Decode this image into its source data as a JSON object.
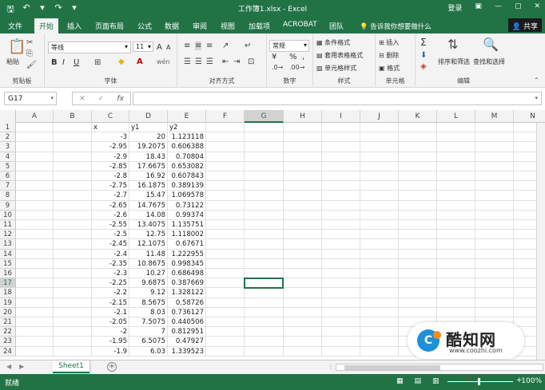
{
  "titlebar": {
    "save_icon": "save-icon",
    "undo": "↶",
    "undo_dd": "▾",
    "redo": "↷",
    "customize": "▾",
    "title": "工作簿1.xlsx  -  Excel",
    "signin": "登录",
    "ribbon_opts": "▣",
    "minimize": "—",
    "restore": "▢",
    "close": "✕"
  },
  "tabs": [
    "文件",
    "开始",
    "插入",
    "页面布局",
    "公式",
    "数据",
    "审阅",
    "视图",
    "加载项",
    "ACROBAT",
    "团队"
  ],
  "active_tab": "开始",
  "tellme": "告诉我你想要做什么",
  "share": "共享",
  "ribbon": {
    "clipboard": {
      "label": "剪贴板",
      "paste": "粘贴",
      "cut": "✂",
      "copy": "⎘",
      "painter": "🖌"
    },
    "font": {
      "label": "字体",
      "font_name": "等线",
      "font_size": "11",
      "grow": "A",
      "shrink": "A",
      "bold": "B",
      "italic": "I",
      "underline": "U",
      "wen": "wén"
    },
    "alignment": {
      "label": "对齐方式"
    },
    "number": {
      "label": "数字",
      "format": "常规",
      "currency": "¥",
      "percent": "%",
      "comma": ","
    },
    "styles": {
      "label": "样式",
      "cond": "条件格式",
      "table": "套用表格格式",
      "cell": "单元格样式"
    },
    "cells": {
      "label": "单元格",
      "insert": "插入",
      "delete": "删除",
      "format": "格式"
    },
    "editing": {
      "label": "编辑",
      "sum": "Σ",
      "sort": "排序和筛选",
      "find": "查找和选择"
    }
  },
  "formula_bar": {
    "name_box": "G17",
    "cancel": "✕",
    "enter": "✓",
    "fx": "fx",
    "value": ""
  },
  "columns": [
    "A",
    "B",
    "C",
    "D",
    "E",
    "F",
    "G",
    "H",
    "I",
    "J",
    "K",
    "L",
    "M",
    "N"
  ],
  "selected_cell": "G17",
  "headers": {
    "row": 1,
    "c": "x",
    "d": "y1",
    "e": "y2"
  },
  "rows": [
    {
      "r": 2,
      "x": "-3",
      "y1": "20",
      "y2": "1.123118"
    },
    {
      "r": 3,
      "x": "-2.95",
      "y1": "19.2075",
      "y2": "0.606388"
    },
    {
      "r": 4,
      "x": "-2.9",
      "y1": "18.43",
      "y2": "0.70804"
    },
    {
      "r": 5,
      "x": "-2.85",
      "y1": "17.6675",
      "y2": "0.653082"
    },
    {
      "r": 6,
      "x": "-2.8",
      "y1": "16.92",
      "y2": "0.607843"
    },
    {
      "r": 7,
      "x": "-2.75",
      "y1": "16.1875",
      "y2": "0.389139"
    },
    {
      "r": 8,
      "x": "-2.7",
      "y1": "15.47",
      "y2": "1.069578"
    },
    {
      "r": 9,
      "x": "-2.65",
      "y1": "14.7675",
      "y2": "0.73122"
    },
    {
      "r": 10,
      "x": "-2.6",
      "y1": "14.08",
      "y2": "0.99374"
    },
    {
      "r": 11,
      "x": "-2.55",
      "y1": "13.4075",
      "y2": "1.135751"
    },
    {
      "r": 12,
      "x": "-2.5",
      "y1": "12.75",
      "y2": "1.118002"
    },
    {
      "r": 13,
      "x": "-2.45",
      "y1": "12.1075",
      "y2": "0.67671"
    },
    {
      "r": 14,
      "x": "-2.4",
      "y1": "11.48",
      "y2": "1.222955"
    },
    {
      "r": 15,
      "x": "-2.35",
      "y1": "10.8675",
      "y2": "0.998345"
    },
    {
      "r": 16,
      "x": "-2.3",
      "y1": "10.27",
      "y2": "0.686498"
    },
    {
      "r": 17,
      "x": "-2.25",
      "y1": "9.6875",
      "y2": "0.387669"
    },
    {
      "r": 18,
      "x": "-2.2",
      "y1": "9.12",
      "y2": "1.328122"
    },
    {
      "r": 19,
      "x": "-2.15",
      "y1": "8.5675",
      "y2": "0.58726"
    },
    {
      "r": 20,
      "x": "-2.1",
      "y1": "8.03",
      "y2": "0.736127"
    },
    {
      "r": 21,
      "x": "-2.05",
      "y1": "7.5075",
      "y2": "0.440506"
    },
    {
      "r": 22,
      "x": "-2",
      "y1": "7",
      "y2": "0.812951"
    },
    {
      "r": 23,
      "x": "-1.95",
      "y1": "6.5075",
      "y2": "0.47927"
    },
    {
      "r": 24,
      "x": "-1.9",
      "y1": "6.03",
      "y2": "1.339523"
    }
  ],
  "sheet_tab": "Sheet1",
  "add_sheet": "+",
  "status": {
    "ready": "就绪",
    "zoom": "100%",
    "minus": "-",
    "plus": "+"
  },
  "watermark": {
    "name": "酷知网",
    "url": "www.coozhi.com",
    "logo": "C"
  }
}
